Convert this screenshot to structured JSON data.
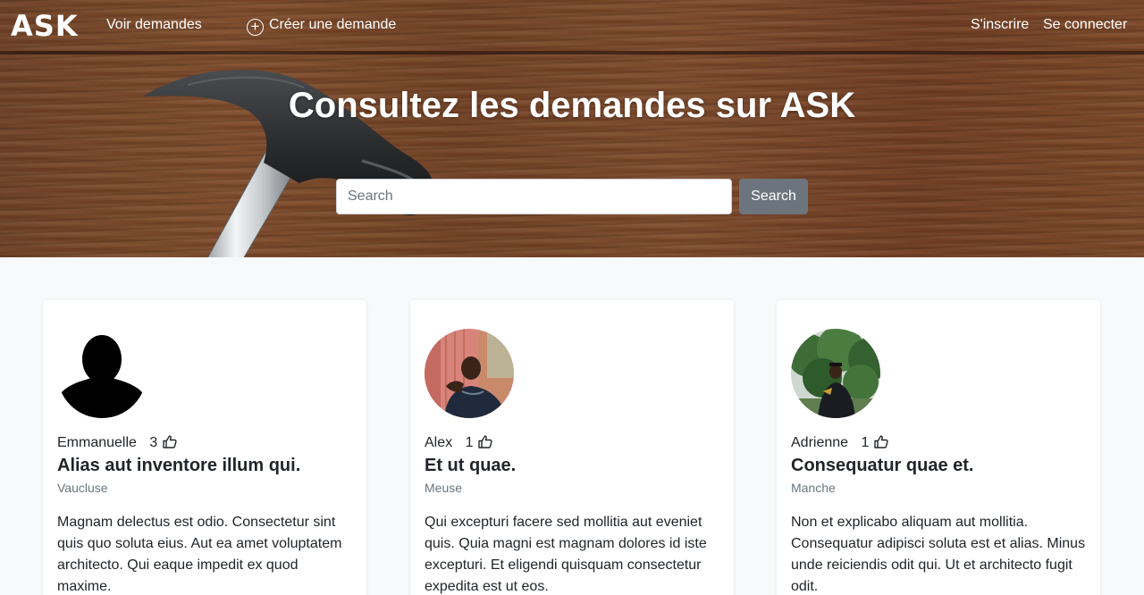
{
  "nav": {
    "brand": "ASK",
    "view_requests": "Voir demandes",
    "create_request": "Créer une demande",
    "signup": "S'inscrire",
    "login": "Se connecter"
  },
  "hero": {
    "title": "Consultez les demandes sur ASK",
    "search_placeholder": "Search",
    "search_button": "Search"
  },
  "cards": [
    {
      "user": "Emmanuelle",
      "likes": "3",
      "title": "Alias aut inventore illum qui.",
      "location": "Vaucluse",
      "description": "Magnam delectus est odio. Consectetur sint quis quo soluta eius. Aut ea amet voluptatem architecto. Qui eaque impedit ex quod maxime.",
      "avatar": "default-silhouette"
    },
    {
      "user": "Alex",
      "likes": "1",
      "title": "Et ut quae.",
      "location": "Meuse",
      "description": "Qui excepturi facere sed mollitia aut eveniet quis. Quia magni est magnam dolores id iste excepturi. Et eligendi quisquam consectetur expedita est ut eos.",
      "avatar": "photo-man-red-wall"
    },
    {
      "user": "Adrienne",
      "likes": "1",
      "title": "Consequatur quae et.",
      "location": "Manche",
      "description": "Non et explicabo aliquam aut mollitia. Consequatur adipisci soluta est et alias. Minus unde reiciendis odit qui. Ut et architecto fugit odit.",
      "avatar": "photo-man-trees"
    }
  ],
  "colors": {
    "search_button": "#6c757d",
    "page_background": "#f8f9fa",
    "card_background": "#ffffff"
  }
}
